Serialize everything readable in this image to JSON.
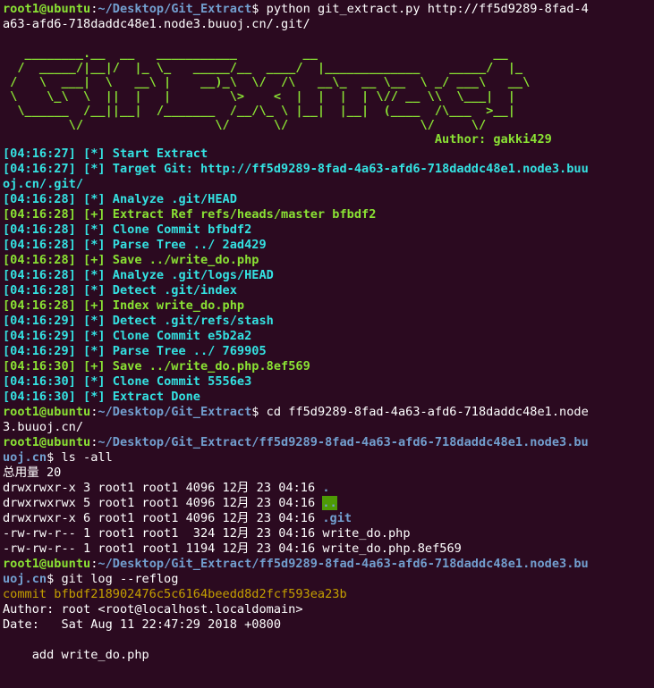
{
  "prompt_user": "root1@ubuntu",
  "prompt_dir1": "~/Desktop/Git_Extract",
  "cmd1_a": "python git_extract.py http://ff5d9289-8fad-4",
  "cmd1_b": "a63-afd6-718daddc48e1.node3.buuoj.cn/.git/",
  "art": [
    "",
    "   ________.__  __   ___________         __                        __   ",
    "  /  _____/|__|/  |_ \\_   _____/__  ____/  |_____________    _____/  |_ ",
    " /   \\  ___|  \\   __\\ |    __)_\\  \\/  /\\   __\\_  __ \\__  \\ _/ ___\\   __\\",
    " \\    \\_\\  \\  ||  |   |        \\>    <  |  |  |  | \\// __ \\\\  \\___|  |  ",
    "  \\______  /__||__|  /_______  /__/\\_ \\ |__|  |__|  (____  /\\___  >__|  ",
    "         \\/                  \\/      \\/                  \\/     \\/      ",
    "                                                           Author: gakki429"
  ],
  "logs": [
    {
      "time": "[04:16:27]",
      "tag": "[*]",
      "msg": "Start Extract",
      "color": "cy"
    },
    {
      "time": "[04:16:27]",
      "tag": "[*]",
      "msg": "Target Git: http://ff5d9289-8fad-4a63-afd6-718daddc48e1.node3.buu",
      "color": "cy"
    },
    {
      "time": "",
      "tag": "",
      "msg": "oj.cn/.git/",
      "color": "cy"
    },
    {
      "time": "[04:16:28]",
      "tag": "[*]",
      "msg": "Analyze .git/HEAD",
      "color": "cy"
    },
    {
      "time": "[04:16:28]",
      "tag": "[+]",
      "msg": "Extract Ref refs/heads/master bfbdf2",
      "color": "gr"
    },
    {
      "time": "[04:16:28]",
      "tag": "[*]",
      "msg": "Clone Commit bfbdf2",
      "color": "cy"
    },
    {
      "time": "[04:16:28]",
      "tag": "[*]",
      "msg": "Parse Tree ../ 2ad429",
      "color": "cy"
    },
    {
      "time": "[04:16:28]",
      "tag": "[+]",
      "msg": "Save ../write_do.php",
      "color": "gr"
    },
    {
      "time": "[04:16:28]",
      "tag": "[*]",
      "msg": "Analyze .git/logs/HEAD",
      "color": "cy"
    },
    {
      "time": "[04:16:28]",
      "tag": "[*]",
      "msg": "Detect .git/index",
      "color": "cy"
    },
    {
      "time": "[04:16:28]",
      "tag": "[+]",
      "msg": "Index write_do.php",
      "color": "gr"
    },
    {
      "time": "[04:16:29]",
      "tag": "[*]",
      "msg": "Detect .git/refs/stash",
      "color": "cy"
    },
    {
      "time": "[04:16:29]",
      "tag": "[*]",
      "msg": "Clone Commit e5b2a2",
      "color": "cy"
    },
    {
      "time": "[04:16:29]",
      "tag": "[*]",
      "msg": "Parse Tree ../ 769905",
      "color": "cy"
    },
    {
      "time": "[04:16:30]",
      "tag": "[+]",
      "msg": "Save ../write_do.php.8ef569",
      "color": "gr"
    },
    {
      "time": "[04:16:30]",
      "tag": "[*]",
      "msg": "Clone Commit 5556e3",
      "color": "cy"
    },
    {
      "time": "[04:16:30]",
      "tag": "[*]",
      "msg": "Extract Done",
      "color": "cy"
    }
  ],
  "cmd2_a": "cd ff5d9289-8fad-4a63-afd6-718daddc48e1.node",
  "cmd2_b": "3.buuoj.cn/",
  "prompt_dir2_a": "~/Desktop/Git_Extract/ff5d9289-8fad-4a63-afd6-718daddc48e1.node3.bu",
  "prompt_dir2_b": "uoj.cn",
  "cmd3": "ls -all",
  "total": "总用量 20",
  "ls_rows": [
    {
      "meta": "drwxrwxr-x 3 root1 root1 4096 12月 23 04:16 ",
      "name": ".",
      "style": "bl"
    },
    {
      "meta": "drwxrwxrwx 5 root1 root1 4096 12月 23 04:16 ",
      "name": "..",
      "style": "hl"
    },
    {
      "meta": "drwxrwxr-x 6 root1 root1 4096 12月 23 04:16 ",
      "name": ".git",
      "style": "bl"
    },
    {
      "meta": "-rw-rw-r-- 1 root1 root1  324 12月 23 04:16 ",
      "name": "write_do.php",
      "style": ""
    },
    {
      "meta": "-rw-rw-r-- 1 root1 root1 1194 12月 23 04:16 ",
      "name": "write_do.php.8ef569",
      "style": ""
    }
  ],
  "cmd4": "git log --reflog",
  "commit_line": "commit bfbdf218902476c5c6164beedd8d2fcf593ea23b",
  "author_line": "Author: root <root@localhost.localdomain>",
  "date_line": "Date:   Sat Aug 11 22:47:29 2018 +0800",
  "msg_line": "    add write_do.php"
}
